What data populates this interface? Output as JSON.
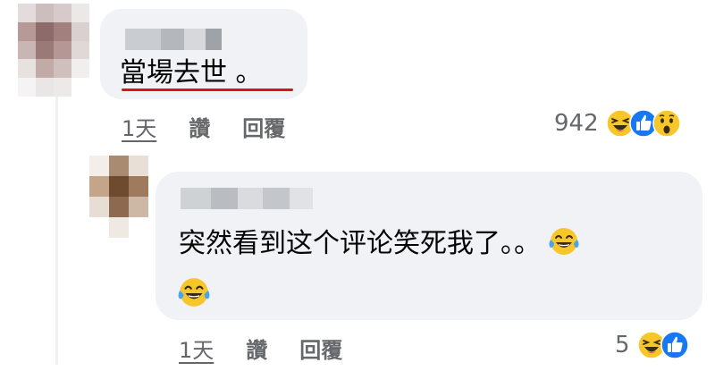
{
  "comment": {
    "text": "當場去世 。",
    "time": "1天",
    "like_label": "讚",
    "reply_label": "回覆",
    "reaction_count": "942",
    "reaction_icons": [
      "laughing-face-icon",
      "thumbs-up-icon",
      "wow-face-icon"
    ]
  },
  "reply": {
    "text": "突然看到这个评论笑死我了。。",
    "trailing_emoji": [
      "tears-of-joy-emoji",
      "tears-of-joy-emoji"
    ],
    "time": "1天",
    "like_label": "讚",
    "reply_label": "回覆",
    "reaction_count": "5",
    "reaction_icons": [
      "laughing-face-icon",
      "thumbs-up-icon"
    ]
  },
  "colors": {
    "bubble": "#f0f2f5",
    "meta_text": "#65676b",
    "underline": "#e0101c",
    "like_blue": "#1877f2",
    "emoji_yellow": "#f7c62a"
  }
}
